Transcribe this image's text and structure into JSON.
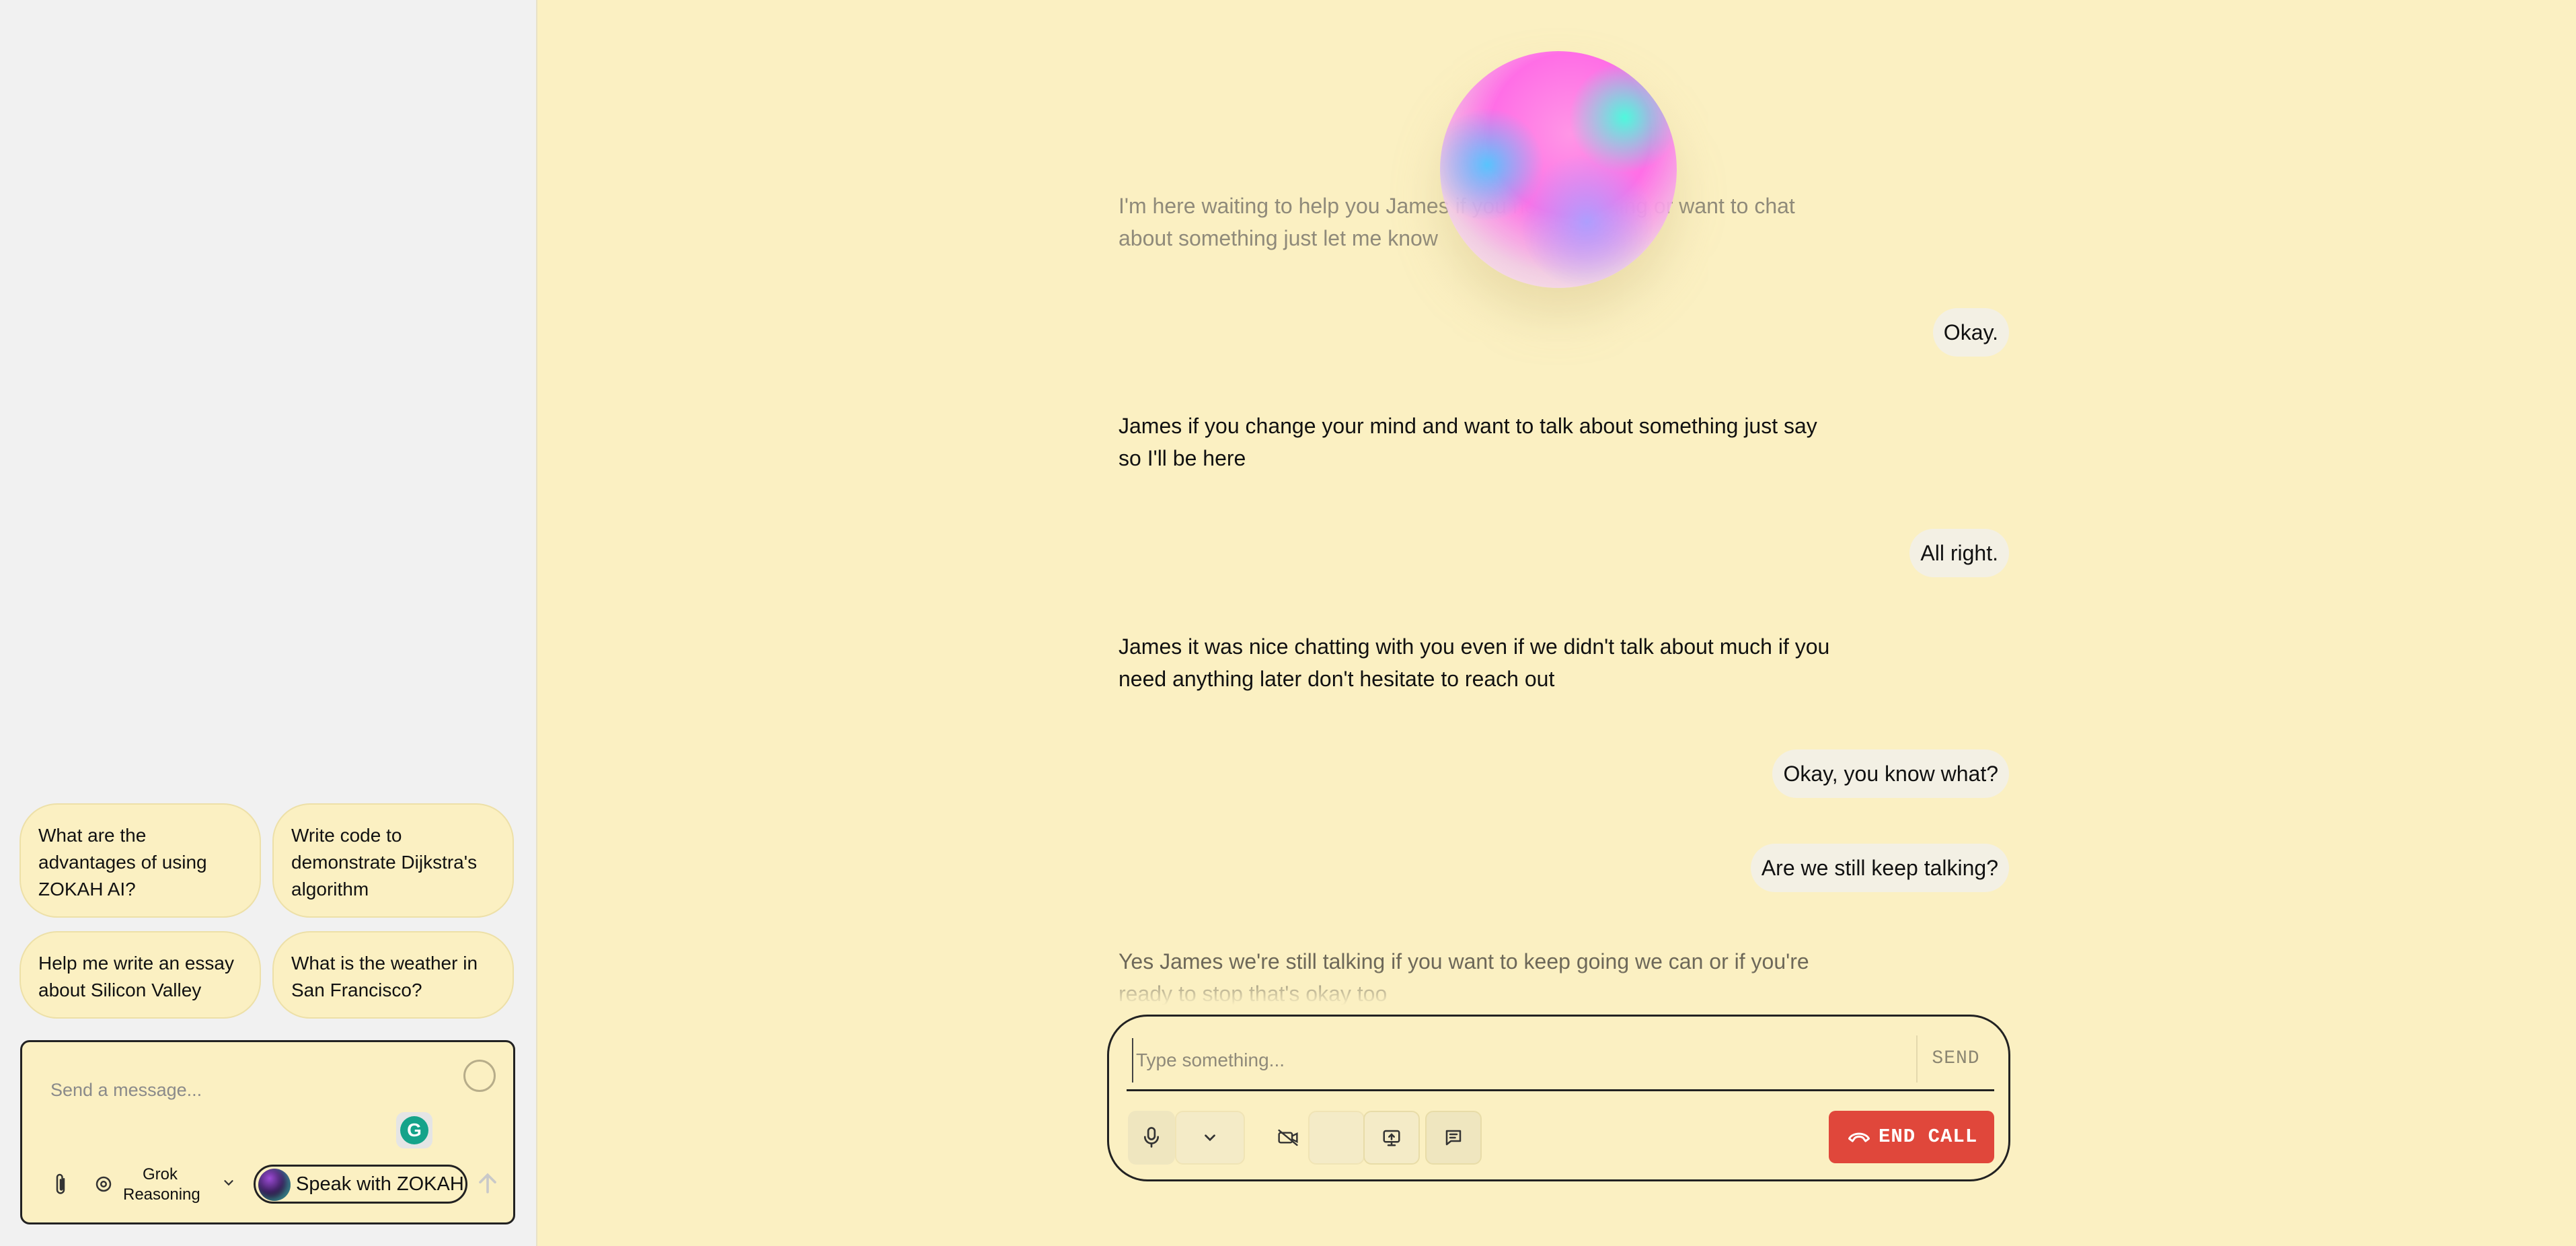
{
  "sidebar": {
    "suggestions": [
      {
        "text": "What are the advantages of using ZOKAH AI?"
      },
      {
        "text": "Write code to demonstrate Dijkstra's algorithm"
      },
      {
        "text": "Help me write an essay about Silicon Valley"
      },
      {
        "text": "What is the weather in San Francisco?"
      }
    ],
    "composer": {
      "placeholder": "Send a message...",
      "model_label_line1": "Grok",
      "model_label_line2": "Reasoning",
      "speak_label": "Speak with ZOKAH",
      "grammarly_glyph": "G"
    }
  },
  "conversation": [
    {
      "role": "assistant",
      "text": "I'm here waiting to help you James if you need anything or want to chat about something just let me know"
    },
    {
      "role": "user",
      "text": "Okay."
    },
    {
      "role": "assistant",
      "text": "James if you change your mind and want to talk about something just say so I'll be here"
    },
    {
      "role": "user",
      "text": "All right."
    },
    {
      "role": "assistant",
      "text": "James it was nice chatting with you even if we didn't talk about much if you need anything later don't hesitate to reach out"
    },
    {
      "role": "user",
      "text": "Okay, you know what?"
    },
    {
      "role": "user",
      "text": "Are we still keep talking?"
    },
    {
      "role": "assistant",
      "text": "Yes James we're still talking if you want to keep going we can or if you're ready to stop that's okay too"
    }
  ],
  "call_panel": {
    "input_placeholder": "Type something...",
    "send_label": "SEND",
    "end_call_label": "END CALL"
  },
  "colors": {
    "background": "#fbf0c2",
    "sidebar": "#f1f1f1",
    "end_call": "#e0473b",
    "grammarly": "#15a38a"
  }
}
